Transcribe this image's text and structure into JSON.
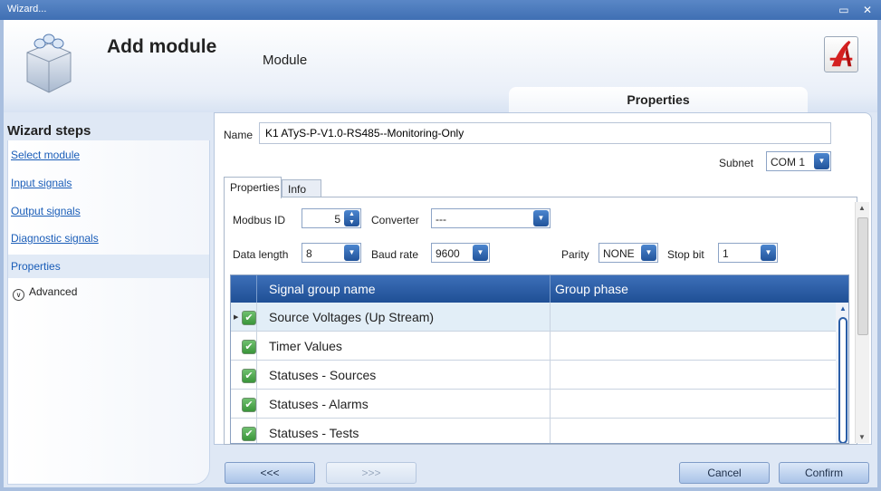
{
  "window": {
    "title": "Wizard...",
    "controls": "▭ ✕"
  },
  "header": {
    "title": "Add module",
    "subtitle": "Module",
    "tab_label": "Properties"
  },
  "steps": {
    "title": "Wizard steps",
    "items": [
      {
        "label": "Select module"
      },
      {
        "label": "Input signals"
      },
      {
        "label": "Output signals"
      },
      {
        "label": "Diagnostic signals"
      },
      {
        "label": "Properties"
      }
    ],
    "advanced": "Advanced"
  },
  "form": {
    "name_label": "Name",
    "name_value": "K1 ATyS-P-V1.0-RS485--Monitoring-Only",
    "subnet_label": "Subnet",
    "subnet_value": "COM 1"
  },
  "tabs": [
    {
      "label": "Properties"
    },
    {
      "label": "Info"
    }
  ],
  "settings": {
    "modbus_id_label": "Modbus ID",
    "modbus_id_value": "5",
    "converter_label": "Converter",
    "converter_value": "---",
    "data_length_label": "Data length",
    "data_length_value": "8",
    "baud_rate_label": "Baud rate",
    "baud_rate_value": "9600",
    "parity_label": "Parity",
    "parity_value": "NONE",
    "stop_bit_label": "Stop bit",
    "stop_bit_value": "1"
  },
  "grid": {
    "columns": [
      "Signal group name",
      "Group phase"
    ],
    "rows": [
      {
        "name": "Source Voltages (Up Stream)",
        "phase": "",
        "checked": true
      },
      {
        "name": "Timer Values",
        "phase": "",
        "checked": true
      },
      {
        "name": "Statuses - Sources",
        "phase": "",
        "checked": true
      },
      {
        "name": "Statuses - Alarms",
        "phase": "",
        "checked": true
      },
      {
        "name": "Statuses - Tests",
        "phase": "",
        "checked": true
      }
    ]
  },
  "footer": {
    "prev": "<<<",
    "next": ">>>",
    "cancel": "Cancel",
    "confirm": "Confirm"
  },
  "colors": {
    "accent": "#2a5ea8",
    "header_blue": "#3f6fb3",
    "check_green": "#3a953a"
  }
}
